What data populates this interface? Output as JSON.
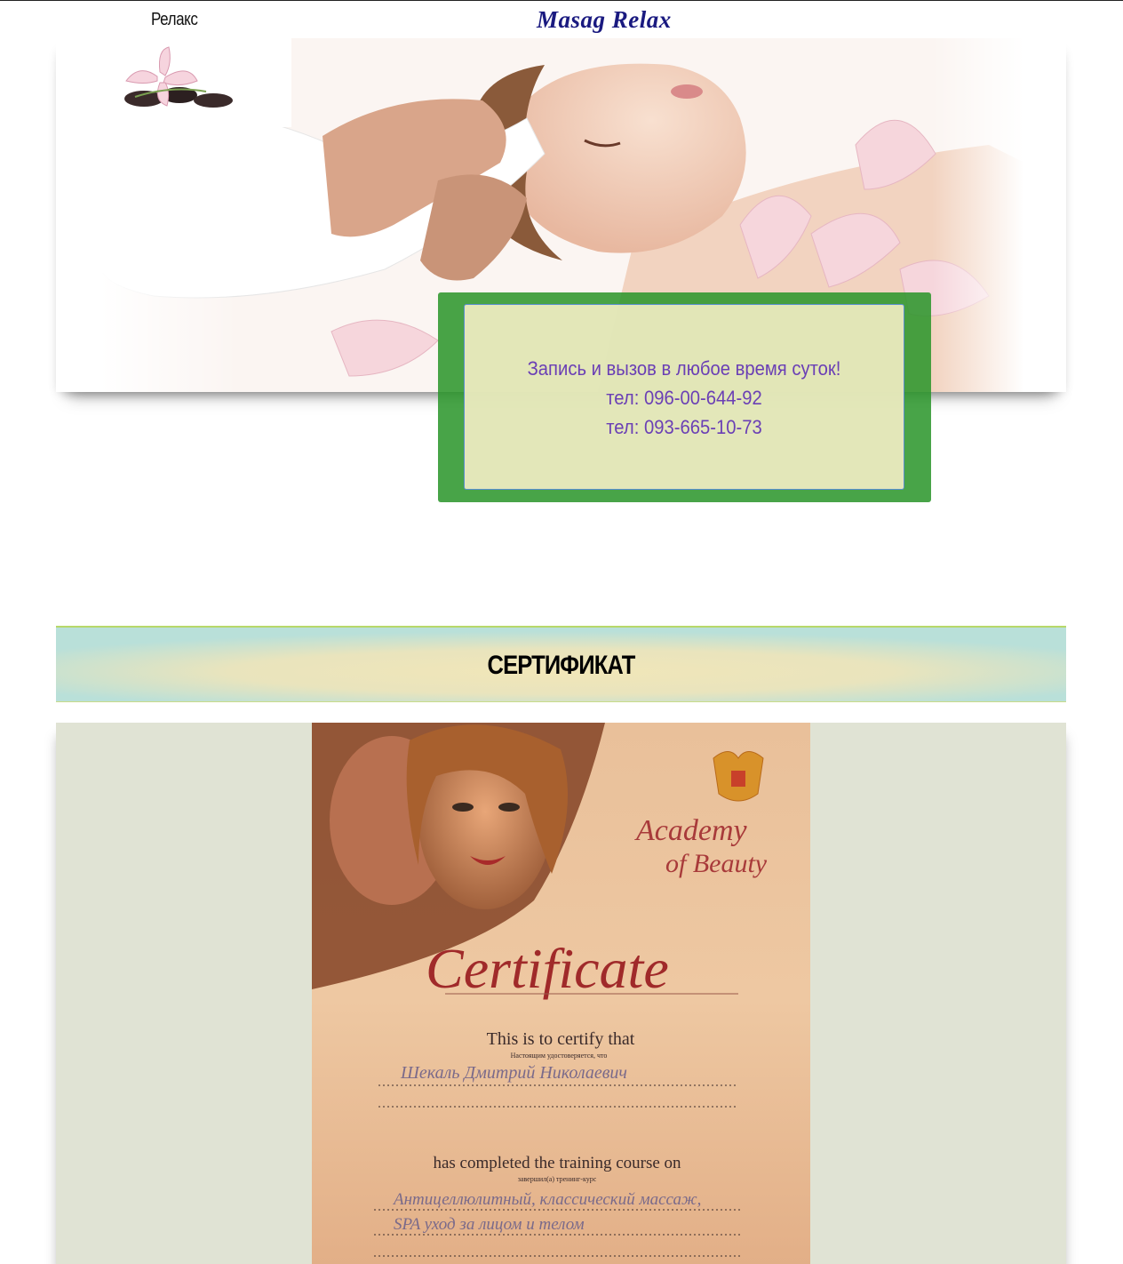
{
  "header": {
    "logo_text": "Релакс",
    "site_title": "Masag Relax"
  },
  "contact": {
    "line1": "Запись и вызов в любое время суток!",
    "line2": "тел: 096-00-644-92",
    "line3": "тел: 093-665-10-73"
  },
  "certificate_section": {
    "heading": "СЕРТИФИКАТ",
    "image": {
      "academy_line1": "Academy",
      "academy_line2": "of Beauty",
      "title": "Certificate",
      "certify_en": "This is to certify that",
      "certify_ru": "Настоящим удостоверяется, что",
      "name_handwritten": "Шекаль Дмитрий Николаевич",
      "completed_en": "has completed the training course on",
      "completed_ru": "завершил(а) тренинг-курс",
      "course_line1": "Антицеллюлитный, классический массаж,",
      "course_line2": "SPA уход за лицом и телом"
    }
  },
  "colors": {
    "title_blue": "#1a1a80",
    "contact_text": "#6a3fb5",
    "contact_outer": "#2e9a2e",
    "contact_inner": "#f8f0c8",
    "banner_border": "#b8d86a",
    "cert_section_bg": "#e0e3d4"
  }
}
